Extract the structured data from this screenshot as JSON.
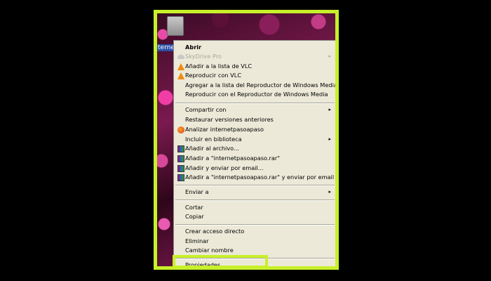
{
  "desktop": {
    "icon_label": "terne"
  },
  "context_menu": {
    "items": [
      {
        "label": "Abrir",
        "bold": true
      },
      {
        "label": "SkyDrive Pro",
        "icon": "onedrive-icon",
        "submenu": true,
        "disabled": true
      },
      {
        "label": "Añadir a la lista de VLC",
        "icon": "vlc-icon"
      },
      {
        "label": "Reproducir con VLC",
        "icon": "vlc-icon"
      },
      {
        "label": "Agregar a la lista del Reproductor de Windows Media"
      },
      {
        "label": "Reproducir con el Reproductor de Windows Media"
      },
      {
        "label": "Compartir con",
        "submenu": true
      },
      {
        "label": "Restaurar versiones anteriores"
      },
      {
        "label": "Analizar internetpasoapaso",
        "icon": "avast-icon"
      },
      {
        "label": "Incluir en biblioteca",
        "submenu": true
      },
      {
        "label": "Añadir al archivo...",
        "icon": "winrar-icon"
      },
      {
        "label": "Añadir a \"internetpasoapaso.rar\"",
        "icon": "winrar-icon"
      },
      {
        "label": "Añadir y enviar por email...",
        "icon": "winrar-icon"
      },
      {
        "label": "Añadir a \"internetpasoapaso.rar\" y enviar por email",
        "icon": "winrar-icon"
      },
      {
        "label": "Enviar a",
        "submenu": true
      },
      {
        "label": "Cortar"
      },
      {
        "label": "Copiar"
      },
      {
        "label": "Crear acceso directo"
      },
      {
        "label": "Eliminar"
      },
      {
        "label": "Cambiar nombre"
      },
      {
        "label": "Propiedades",
        "highlighted": true
      }
    ],
    "submenu_arrow": "▸"
  },
  "colors": {
    "highlight_frame": "#c8f02a",
    "menu_background": "#ece9d8",
    "disabled_text": "#a8a89c"
  }
}
